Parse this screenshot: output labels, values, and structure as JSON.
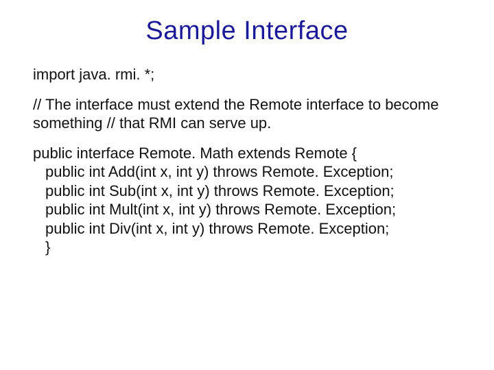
{
  "title": "Sample Interface",
  "import_line": "import java. rmi. *;",
  "comment": "// The interface must extend the Remote interface to become something // that RMI can serve up.",
  "decl": "public interface Remote. Math extends Remote {",
  "m1": "public int Add(int x, int y) throws Remote. Exception;",
  "m2": "public int Sub(int x, int y) throws Remote. Exception;",
  "m3": "public int Mult(int x, int y) throws Remote. Exception;",
  "m4": "public int Div(int x, int y) throws Remote. Exception;",
  "close": "}"
}
